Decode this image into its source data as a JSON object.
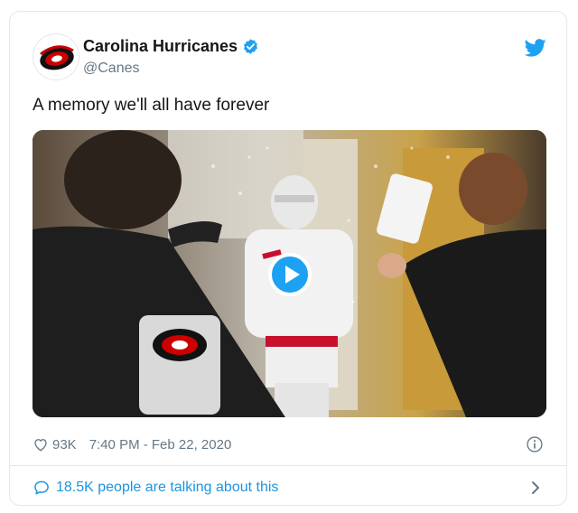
{
  "account": {
    "name": "Carolina Hurricanes",
    "handle": "@Canes"
  },
  "tweet": {
    "text": "A memory we'll all have forever"
  },
  "meta": {
    "likes": "93K",
    "timestamp": "7:40 PM - Feb 22, 2020"
  },
  "footer": {
    "talking": "18.5K people are talking about this"
  },
  "colors": {
    "accent": "#1da1f2",
    "link": "#1b95e0",
    "secondary_text": "#657786",
    "border": "#e1e8ed",
    "brand_red": "#cc0000"
  },
  "icons": [
    "canes-logo",
    "verified-badge-icon",
    "twitter-bird-icon",
    "play-icon",
    "heart-icon",
    "info-icon",
    "speech-bubble-icon",
    "chevron-right-icon"
  ]
}
